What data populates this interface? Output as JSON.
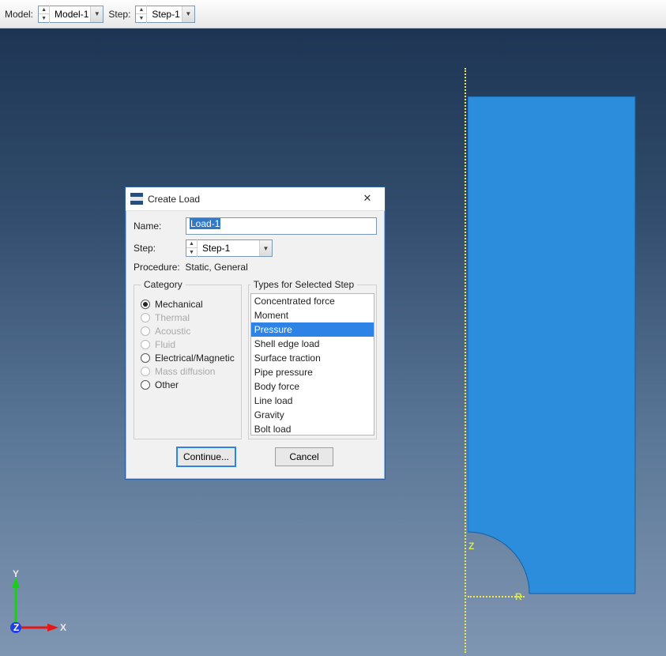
{
  "toolbar": {
    "model_label": "Model:",
    "model_value": "Model-1",
    "step_label": "Step:",
    "step_value": "Step-1"
  },
  "viewport": {
    "axis_z": "Z",
    "axis_r": "R",
    "triad_x": "X",
    "triad_y": "Y",
    "triad_z": "Z"
  },
  "dialog": {
    "title": "Create Load",
    "name_label": "Name:",
    "name_value": "Load-1",
    "step_label": "Step:",
    "step_value": "Step-1",
    "procedure_label": "Procedure:",
    "procedure_value": "Static, General",
    "category_legend": "Category",
    "types_legend": "Types for Selected Step",
    "categories": [
      {
        "label": "Mechanical",
        "enabled": true,
        "checked": true
      },
      {
        "label": "Thermal",
        "enabled": false,
        "checked": false
      },
      {
        "label": "Acoustic",
        "enabled": false,
        "checked": false
      },
      {
        "label": "Fluid",
        "enabled": false,
        "checked": false
      },
      {
        "label": "Electrical/Magnetic",
        "enabled": true,
        "checked": false
      },
      {
        "label": "Mass diffusion",
        "enabled": false,
        "checked": false
      },
      {
        "label": "Other",
        "enabled": true,
        "checked": false
      }
    ],
    "types": [
      {
        "label": "Concentrated force",
        "selected": false
      },
      {
        "label": "Moment",
        "selected": false
      },
      {
        "label": "Pressure",
        "selected": true
      },
      {
        "label": "Shell edge load",
        "selected": false
      },
      {
        "label": "Surface traction",
        "selected": false
      },
      {
        "label": "Pipe pressure",
        "selected": false
      },
      {
        "label": "Body force",
        "selected": false
      },
      {
        "label": "Line load",
        "selected": false
      },
      {
        "label": "Gravity",
        "selected": false
      },
      {
        "label": "Bolt load",
        "selected": false
      }
    ],
    "continue_label": "Continue...",
    "cancel_label": "Cancel"
  }
}
